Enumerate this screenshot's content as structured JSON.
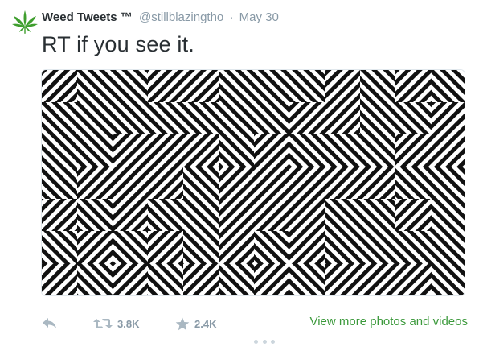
{
  "tweet": {
    "author_name": "Weed Tweets ™",
    "handle": "@stillblazingtho",
    "separator": "·",
    "date": "May 30",
    "text": "RT if you see it.",
    "avatar_icon": "cannabis-leaf-icon",
    "avatar_color": "#3f9e2e"
  },
  "media": {
    "type": "optical-illusion-image",
    "pattern": "black and white diagonal zigzag maze stripes"
  },
  "actions": {
    "reply_icon": "reply-icon",
    "retweet_icon": "retweet-icon",
    "retweet_count": "3.8K",
    "favorite_icon": "star-icon",
    "favorite_count": "2.4K",
    "more_media_link": "View more photos and videos",
    "more_options_icon": "ellipsis-icon",
    "link_color": "#3d9a3d",
    "icon_color": "#aab8c2"
  }
}
